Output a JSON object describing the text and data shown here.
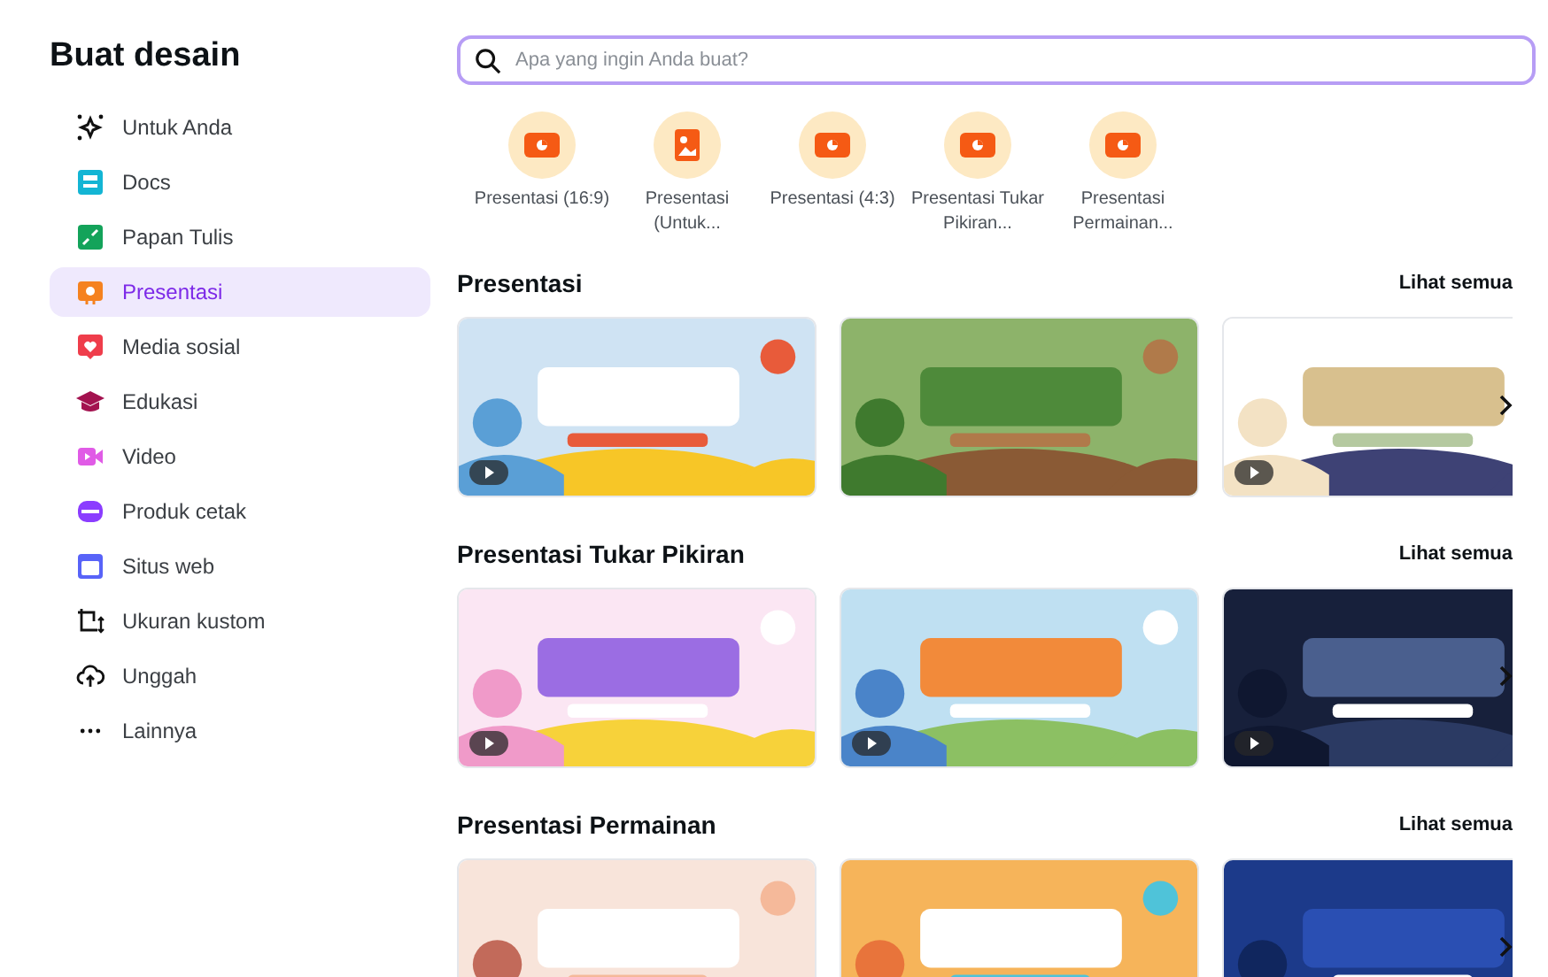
{
  "sidebar": {
    "title": "Buat desain",
    "items": [
      {
        "label": "Untuk Anda",
        "selected": false
      },
      {
        "label": "Docs",
        "selected": false
      },
      {
        "label": "Papan Tulis",
        "selected": false
      },
      {
        "label": "Presentasi",
        "selected": true
      },
      {
        "label": "Media sosial",
        "selected": false
      },
      {
        "label": "Edukasi",
        "selected": false
      },
      {
        "label": "Video",
        "selected": false
      },
      {
        "label": "Produk cetak",
        "selected": false
      },
      {
        "label": "Situs web",
        "selected": false
      },
      {
        "label": "Ukuran kustom",
        "selected": false
      },
      {
        "label": "Unggah",
        "selected": false
      },
      {
        "label": "Lainnya",
        "selected": false
      }
    ]
  },
  "search": {
    "placeholder": "Apa yang ingin Anda buat?"
  },
  "shortcuts": [
    {
      "label": "Presentasi (16:9)"
    },
    {
      "label": "Presentasi (Untuk..."
    },
    {
      "label": "Presentasi (4:3)"
    },
    {
      "label": "Presentasi Tukar Pikiran..."
    },
    {
      "label": "Presentasi Permainan..."
    }
  ],
  "sections": [
    {
      "title": "Presentasi",
      "link": "Lihat semua",
      "cards": [
        {
          "kind": "picture",
          "video": true
        },
        {
          "kind": "picture",
          "video": false
        },
        {
          "kind": "picture",
          "video": true
        }
      ]
    },
    {
      "title": "Presentasi Tukar Pikiran",
      "link": "Lihat semua",
      "cards": [
        {
          "kind": "picture",
          "video": true
        },
        {
          "kind": "picture",
          "video": true
        },
        {
          "kind": "picture",
          "video": true
        }
      ]
    },
    {
      "title": "Presentasi Permainan",
      "link": "Lihat semua",
      "cards": [
        {
          "kind": "picture",
          "video": false
        },
        {
          "kind": "picture",
          "video": false
        },
        {
          "kind": "picture",
          "video": false
        }
      ]
    }
  ]
}
